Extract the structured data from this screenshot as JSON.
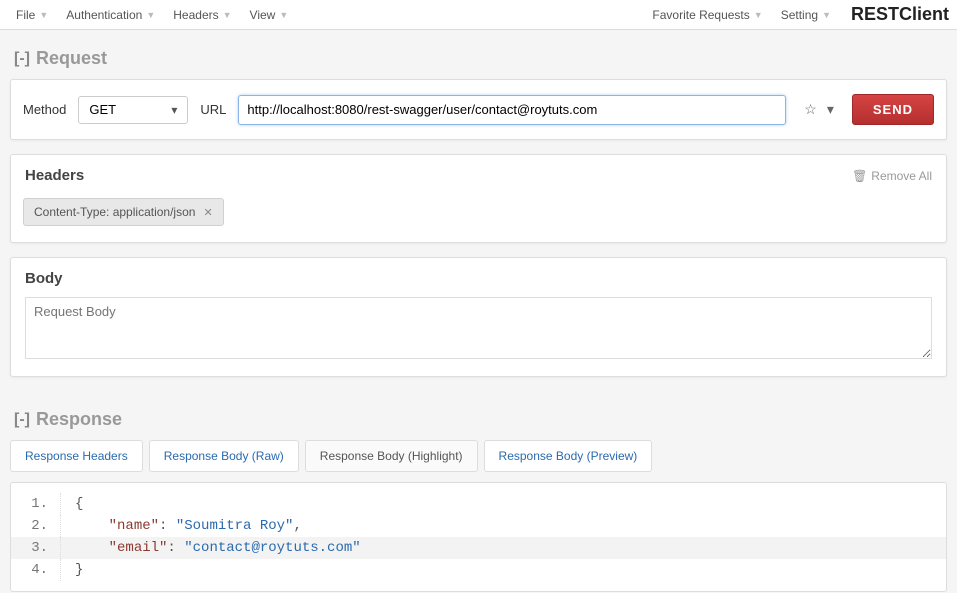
{
  "menus": {
    "left": [
      "File",
      "Authentication",
      "Headers",
      "View"
    ],
    "right": [
      "Favorite Requests",
      "Setting"
    ]
  },
  "brand": "RESTClient",
  "request": {
    "title": "Request",
    "method_label": "Method",
    "method_value": "GET",
    "url_label": "URL",
    "url_value": "http://localhost:8080/rest-swagger/user/contact@roytuts.com",
    "send_label": "SEND"
  },
  "headers": {
    "title": "Headers",
    "remove_all": "Remove All",
    "chips": [
      {
        "label": "Content-Type: application/json"
      }
    ]
  },
  "body": {
    "title": "Body",
    "placeholder": "Request Body"
  },
  "response": {
    "title": "Response",
    "tabs": [
      "Response Headers",
      "Response Body (Raw)",
      "Response Body (Highlight)",
      "Response Body (Preview)"
    ],
    "active_tab": 2,
    "json": {
      "name": "Soumitra Roy",
      "email": "contact@roytuts.com"
    }
  },
  "ln": {
    "1": "1.",
    "2": "2.",
    "3": "3.",
    "4": "4."
  },
  "tok": {
    "obr": "{",
    "cbr": "}",
    "name_k": "\"name\"",
    "name_v": "\"Soumitra Roy\"",
    "email_k": "\"email\"",
    "email_v": "\"contact@roytuts.com\"",
    "colon": ": ",
    "comma": ","
  }
}
